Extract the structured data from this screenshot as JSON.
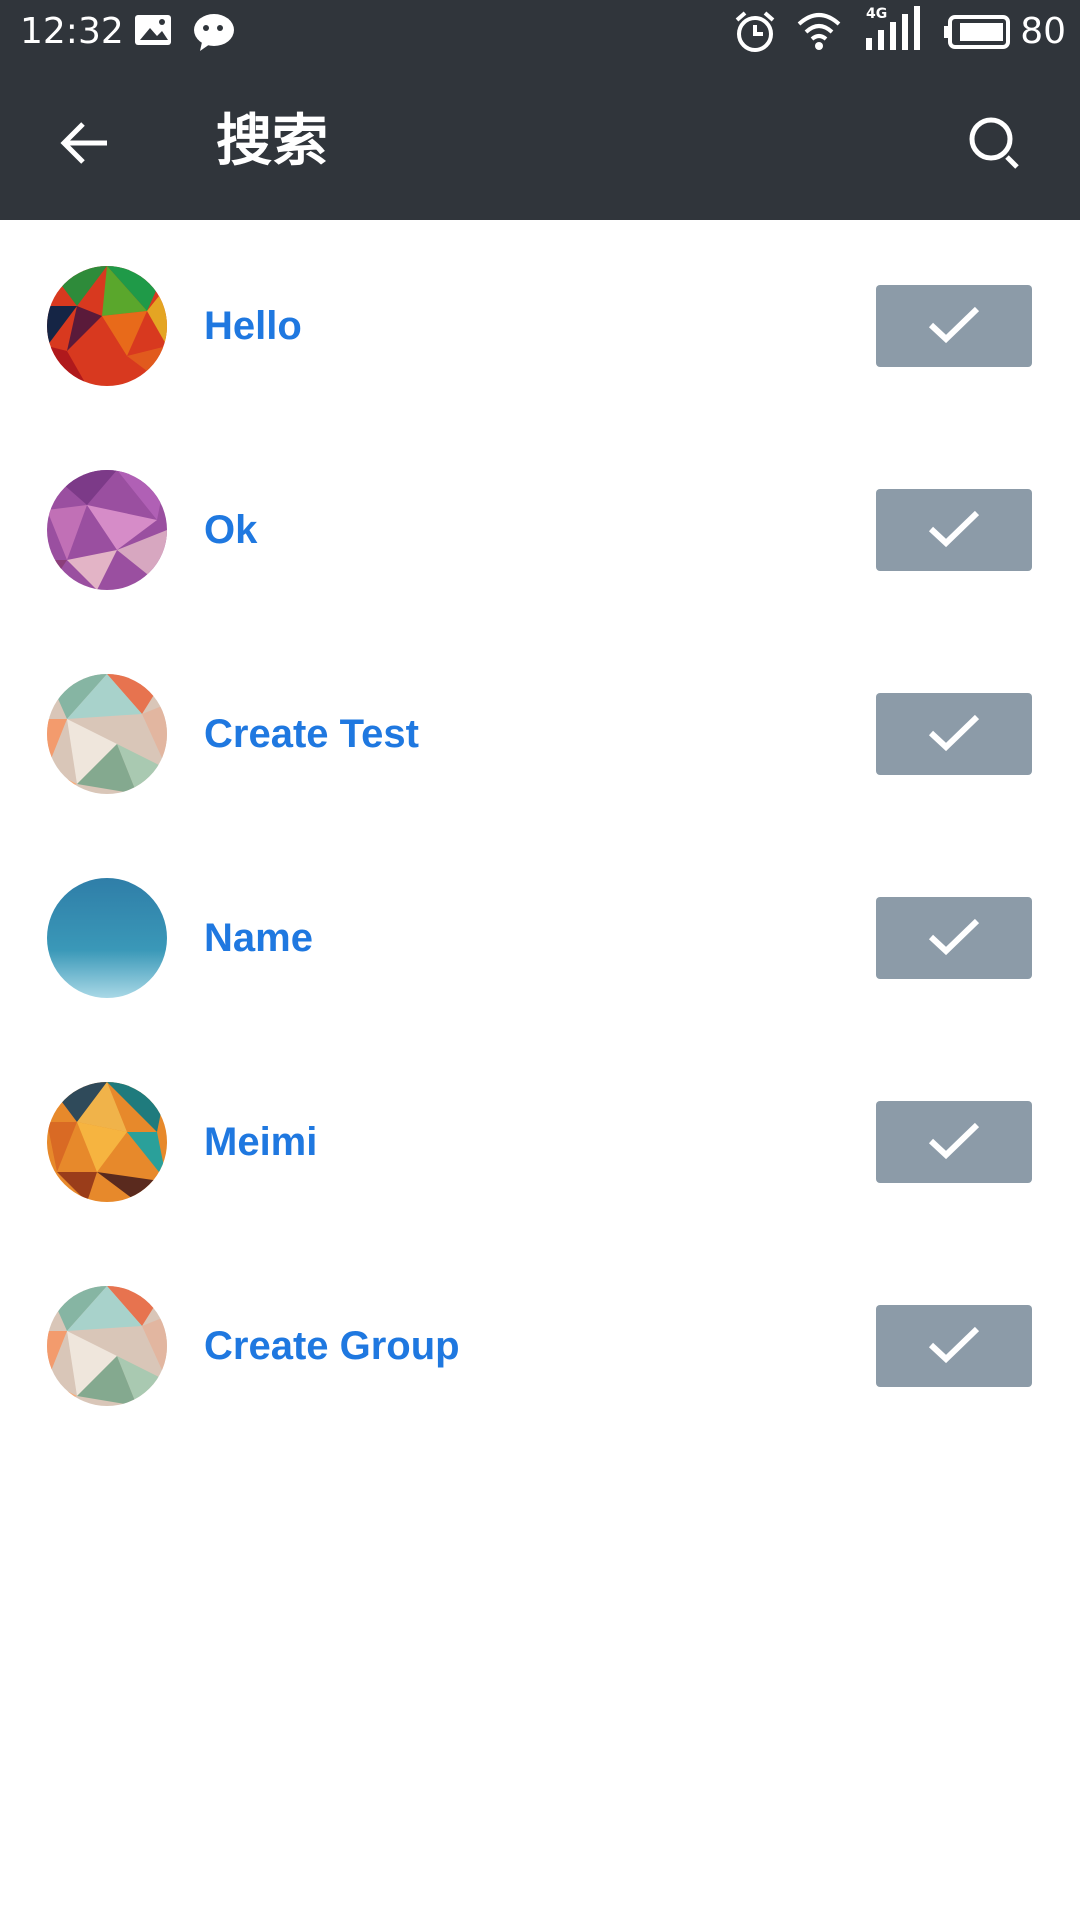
{
  "status_bar": {
    "time": "12:32",
    "battery_level": "80",
    "network_label": "4G",
    "icons": [
      "image-icon",
      "wechat-icon",
      "alarm-icon",
      "wifi-icon",
      "signal-icon",
      "battery-icon"
    ]
  },
  "app_bar": {
    "title": "搜索",
    "back_icon": "arrow-left-icon",
    "search_icon": "search-icon",
    "background": "#30353b"
  },
  "contacts": [
    {
      "name": "Hello",
      "selected": true
    },
    {
      "name": "Ok",
      "selected": true
    },
    {
      "name": "Create Test",
      "selected": true
    },
    {
      "name": "Name",
      "selected": true
    },
    {
      "name": "Meimi",
      "selected": true
    },
    {
      "name": "Create Group",
      "selected": true
    }
  ],
  "colors": {
    "name_text": "#1f78e0",
    "check_button": "#8c9ba8"
  }
}
